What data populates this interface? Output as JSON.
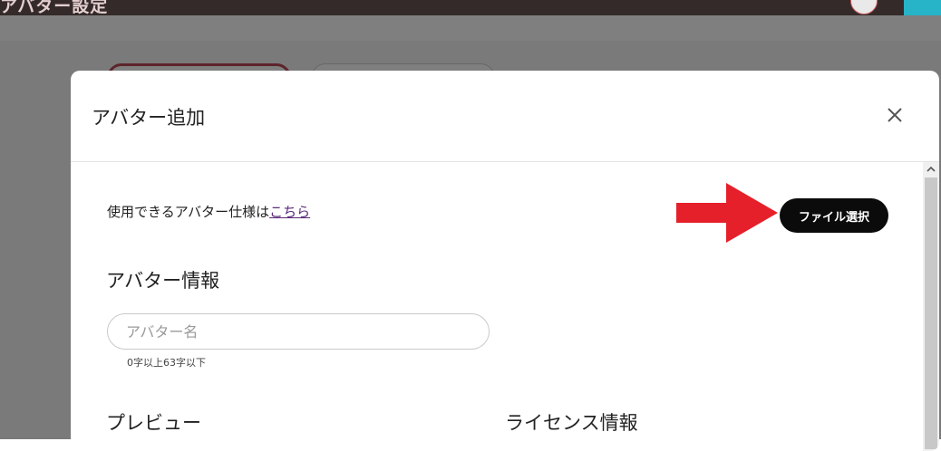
{
  "background": {
    "title": "アバター設定"
  },
  "modal": {
    "title": "アバター追加",
    "close_label": "×",
    "spec_text": "使用できるアバター仕様は",
    "spec_link": "こちら",
    "file_button": "ファイル選択",
    "section_avatar_info": "アバター情報",
    "name_placeholder": "アバター名",
    "name_value": "",
    "name_hint": "0字以上63字以下",
    "section_preview": "プレビュー",
    "section_license": "ライセンス情報"
  },
  "colors": {
    "topbar": "#352a2a",
    "accent": "#27b3c8",
    "arrow": "#e5202a",
    "button": "#0b0b0b"
  },
  "icons": [
    "close-icon",
    "arrow-right-icon",
    "scroll-up-icon",
    "avatar-icon"
  ]
}
